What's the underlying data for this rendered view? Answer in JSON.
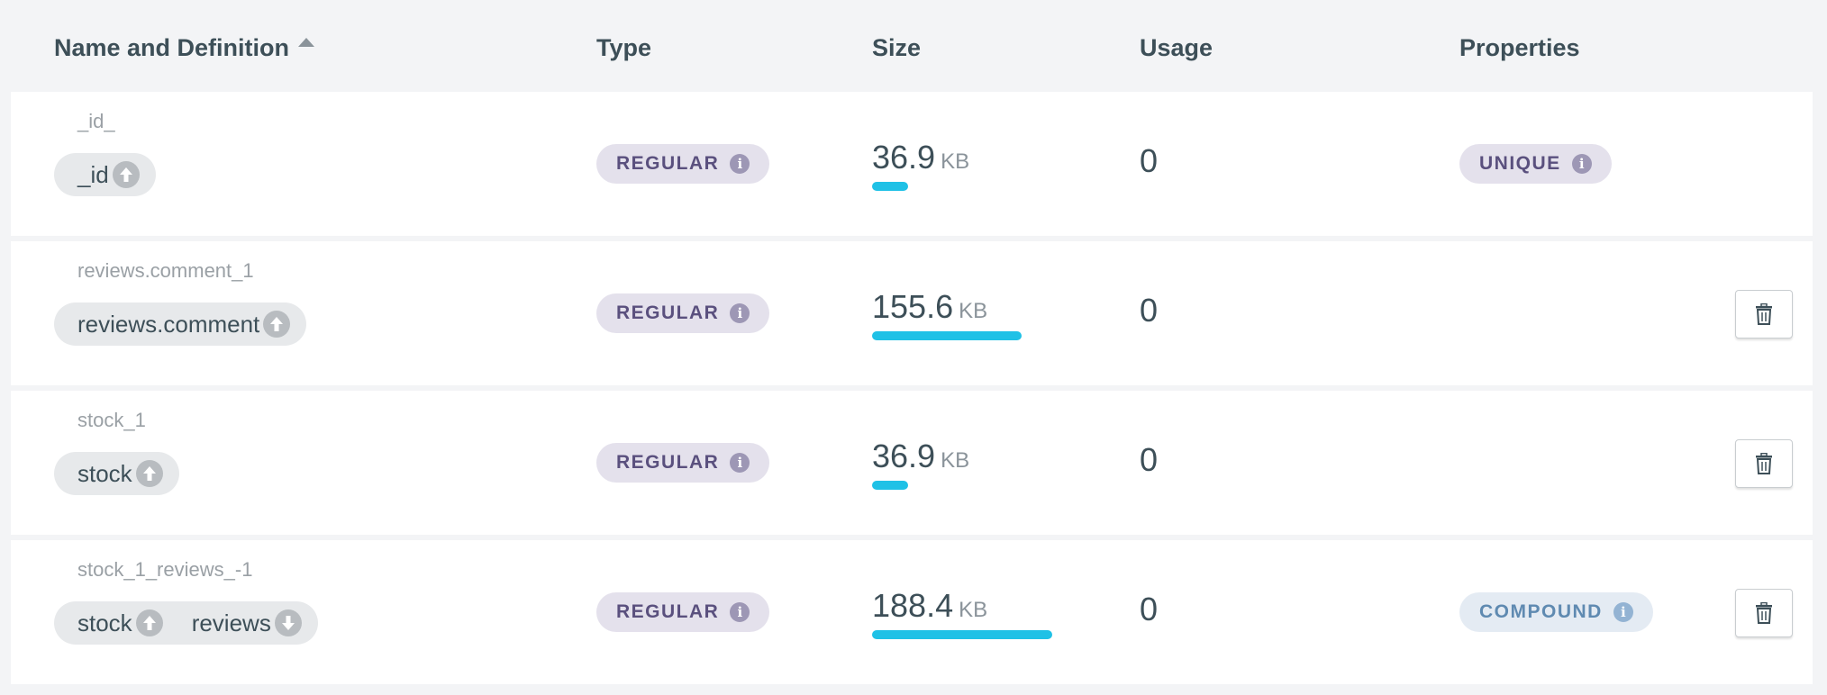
{
  "header": {
    "name": "Name and Definition",
    "type": "Type",
    "size": "Size",
    "usage": "Usage",
    "properties": "Properties",
    "sort_icon": "caret-up-icon"
  },
  "colors": {
    "size_bar": "#1fc1e6",
    "type_badge_bg": "#e4e1ec",
    "compound_badge_text": "#5f8ab1"
  },
  "rows": [
    {
      "index_name": "_id_",
      "fields": [
        {
          "name": "_id",
          "direction": "asc"
        }
      ],
      "type": "REGULAR",
      "size_value": "36.9",
      "size_unit": "KB",
      "size_fraction": 0.2,
      "usage": "0",
      "property": "UNIQUE",
      "deletable": false
    },
    {
      "index_name": "reviews.comment_1",
      "fields": [
        {
          "name": "reviews.comment",
          "direction": "asc"
        }
      ],
      "type": "REGULAR",
      "size_value": "155.6",
      "size_unit": "KB",
      "size_fraction": 0.83,
      "usage": "0",
      "property": "",
      "deletable": true
    },
    {
      "index_name": "stock_1",
      "fields": [
        {
          "name": "stock",
          "direction": "asc"
        }
      ],
      "type": "REGULAR",
      "size_value": "36.9",
      "size_unit": "KB",
      "size_fraction": 0.2,
      "usage": "0",
      "property": "",
      "deletable": true
    },
    {
      "index_name": "stock_1_reviews_-1",
      "fields": [
        {
          "name": "stock",
          "direction": "asc"
        },
        {
          "name": "reviews",
          "direction": "desc"
        }
      ],
      "type": "REGULAR",
      "size_value": "188.4",
      "size_unit": "KB",
      "size_fraction": 1.0,
      "usage": "0",
      "property": "COMPOUND",
      "deletable": true
    }
  ]
}
